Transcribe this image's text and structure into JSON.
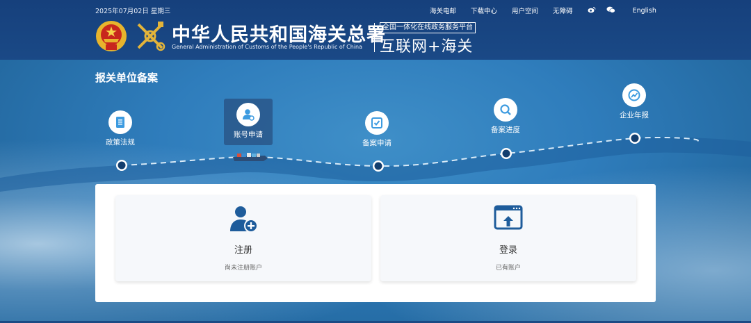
{
  "header": {
    "date": "2025年07月02日 星期三",
    "links": [
      "海关电邮",
      "下载中心",
      "用户空间",
      "无障碍"
    ],
    "icons": [
      "weibo-icon",
      "wechat-icon"
    ],
    "lang": "English",
    "title_cn": "中华人民共和国海关总署",
    "title_en": "General Administration of Customs of the People's Republic of China",
    "slogan_small": "全国一体化在线政务服务平台",
    "slogan_big": "互联网+海关"
  },
  "page": {
    "title": "报关单位备案"
  },
  "steps": [
    {
      "label": "政策法规",
      "icon": "document-icon"
    },
    {
      "label": "账号申请",
      "icon": "user-gear-icon",
      "active": true
    },
    {
      "label": "备案申请",
      "icon": "shield-check-icon"
    },
    {
      "label": "备案进度",
      "icon": "magnifier-icon"
    },
    {
      "label": "企业年报",
      "icon": "report-chart-icon"
    }
  ],
  "cards": {
    "register": {
      "title": "注册",
      "sub": "尚未注册账户",
      "icon": "add-user-icon"
    },
    "login": {
      "title": "登录",
      "sub": "已有账户",
      "icon": "login-screen-icon"
    }
  },
  "colors": {
    "header": "#1a4986",
    "accent": "#1e5c9b",
    "panel": "#ffffff"
  }
}
